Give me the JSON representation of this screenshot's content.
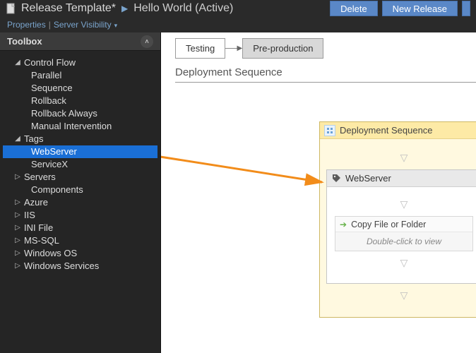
{
  "header": {
    "title": "Release Template*",
    "subtitle": "Hello World (Active)",
    "buttons": {
      "delete": "Delete",
      "new_release": "New Release"
    }
  },
  "linkbar": {
    "properties": "Properties",
    "server_visibility": "Server Visibility"
  },
  "toolbox": {
    "title": "Toolbox",
    "tree": {
      "control_flow": {
        "label": "Control Flow",
        "children": [
          "Parallel",
          "Sequence",
          "Rollback",
          "Rollback Always",
          "Manual Intervention"
        ]
      },
      "tags": {
        "label": "Tags",
        "children": [
          "WebServer",
          "ServiceX"
        ],
        "selected": "WebServer"
      },
      "servers": {
        "label": "Servers",
        "children": [
          "Components"
        ]
      },
      "collapsed": [
        "Azure",
        "IIS",
        "INI File",
        "MS-SQL",
        "Windows OS",
        "Windows Services"
      ]
    }
  },
  "canvas": {
    "stages": {
      "testing": "Testing",
      "preprod": "Pre-production"
    },
    "section_title": "Deployment Sequence",
    "deployment": {
      "title": "Deployment Sequence",
      "server": {
        "name": "WebServer",
        "activity": {
          "label": "Copy File or Folder",
          "hint": "Double-click to view"
        }
      }
    }
  }
}
